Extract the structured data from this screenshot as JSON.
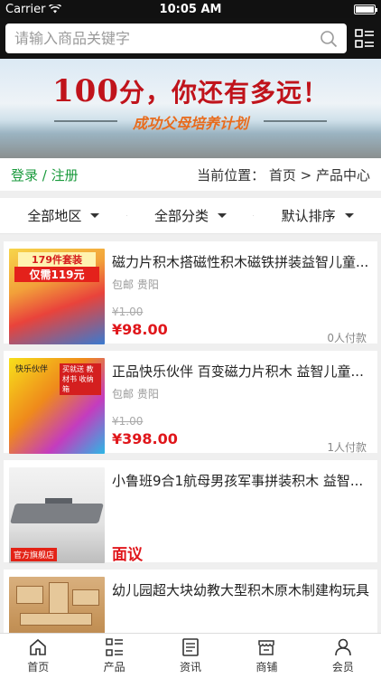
{
  "status_bar": {
    "carrier": "Carrier",
    "time": "10:05 AM"
  },
  "search": {
    "placeholder": "请输入商品关键字"
  },
  "banner": {
    "title_number": "100",
    "title_text": "分，你还有多远！",
    "subtitle": "成功父母培养计划"
  },
  "location": {
    "login": "登录 / 注册",
    "breadcrumb": "当前位置： 首页 > 产品中心"
  },
  "filters": [
    {
      "label": "全部地区"
    },
    {
      "label": "全部分类"
    },
    {
      "label": "默认排序"
    }
  ],
  "products": [
    {
      "name": "磁力片积木搭磁性积木磁铁拼装益智儿童...",
      "shipping": "包邮 贵阳",
      "old_price": "¥1.00",
      "price": "¥98.00",
      "sold": "0人付款",
      "thumb_tag1": "179件套装",
      "thumb_tag2": "仅需119元"
    },
    {
      "name": "正品快乐伙伴 百变磁力片积木 益智儿童...",
      "shipping": "包邮 贵阳",
      "old_price": "¥1.00",
      "price": "¥398.00",
      "sold": "1人付款",
      "thumb_tag1": "快乐伙伴",
      "thumb_tag2": "买就送 教材书 收纳箱"
    },
    {
      "name": "小鲁班9合1航母男孩军事拼装积木 益智...",
      "negotiable": "面议",
      "thumb_tag1": "官方旗舰店"
    },
    {
      "name": "幼儿园超大块幼教大型积木原木制建构玩具"
    }
  ],
  "tabs": [
    {
      "label": "首页",
      "icon": "home-icon"
    },
    {
      "label": "产品",
      "icon": "grid-list-icon"
    },
    {
      "label": "资讯",
      "icon": "news-icon"
    },
    {
      "label": "商铺",
      "icon": "store-icon"
    },
    {
      "label": "会员",
      "icon": "user-icon"
    }
  ],
  "colors": {
    "accent_green": "#1a9a3c",
    "price_red": "#e0161b",
    "header_bg": "#121212"
  }
}
